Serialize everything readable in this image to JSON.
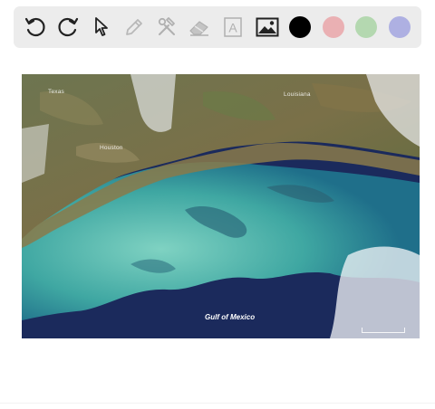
{
  "toolbar": {
    "tools": [
      {
        "name": "undo-icon",
        "tooltip": "Undo"
      },
      {
        "name": "redo-icon",
        "tooltip": "Redo"
      },
      {
        "name": "select-pointer-icon",
        "tooltip": "Select"
      },
      {
        "name": "pencil-icon",
        "tooltip": "Pencil"
      },
      {
        "name": "tools-icon",
        "tooltip": "Tools"
      },
      {
        "name": "eraser-icon",
        "tooltip": "Eraser"
      },
      {
        "name": "text-icon",
        "tooltip": "Text",
        "glyph": "A"
      },
      {
        "name": "image-icon",
        "tooltip": "Image"
      }
    ],
    "colors": [
      "#000000",
      "#eab0b3",
      "#b4d8b0",
      "#aeb0e2"
    ]
  },
  "canvas": {
    "labels": {
      "texas": "Texas",
      "louisiana": "Louisiana",
      "houston": "Houston",
      "gulf": "Gulf of Mexico"
    }
  }
}
